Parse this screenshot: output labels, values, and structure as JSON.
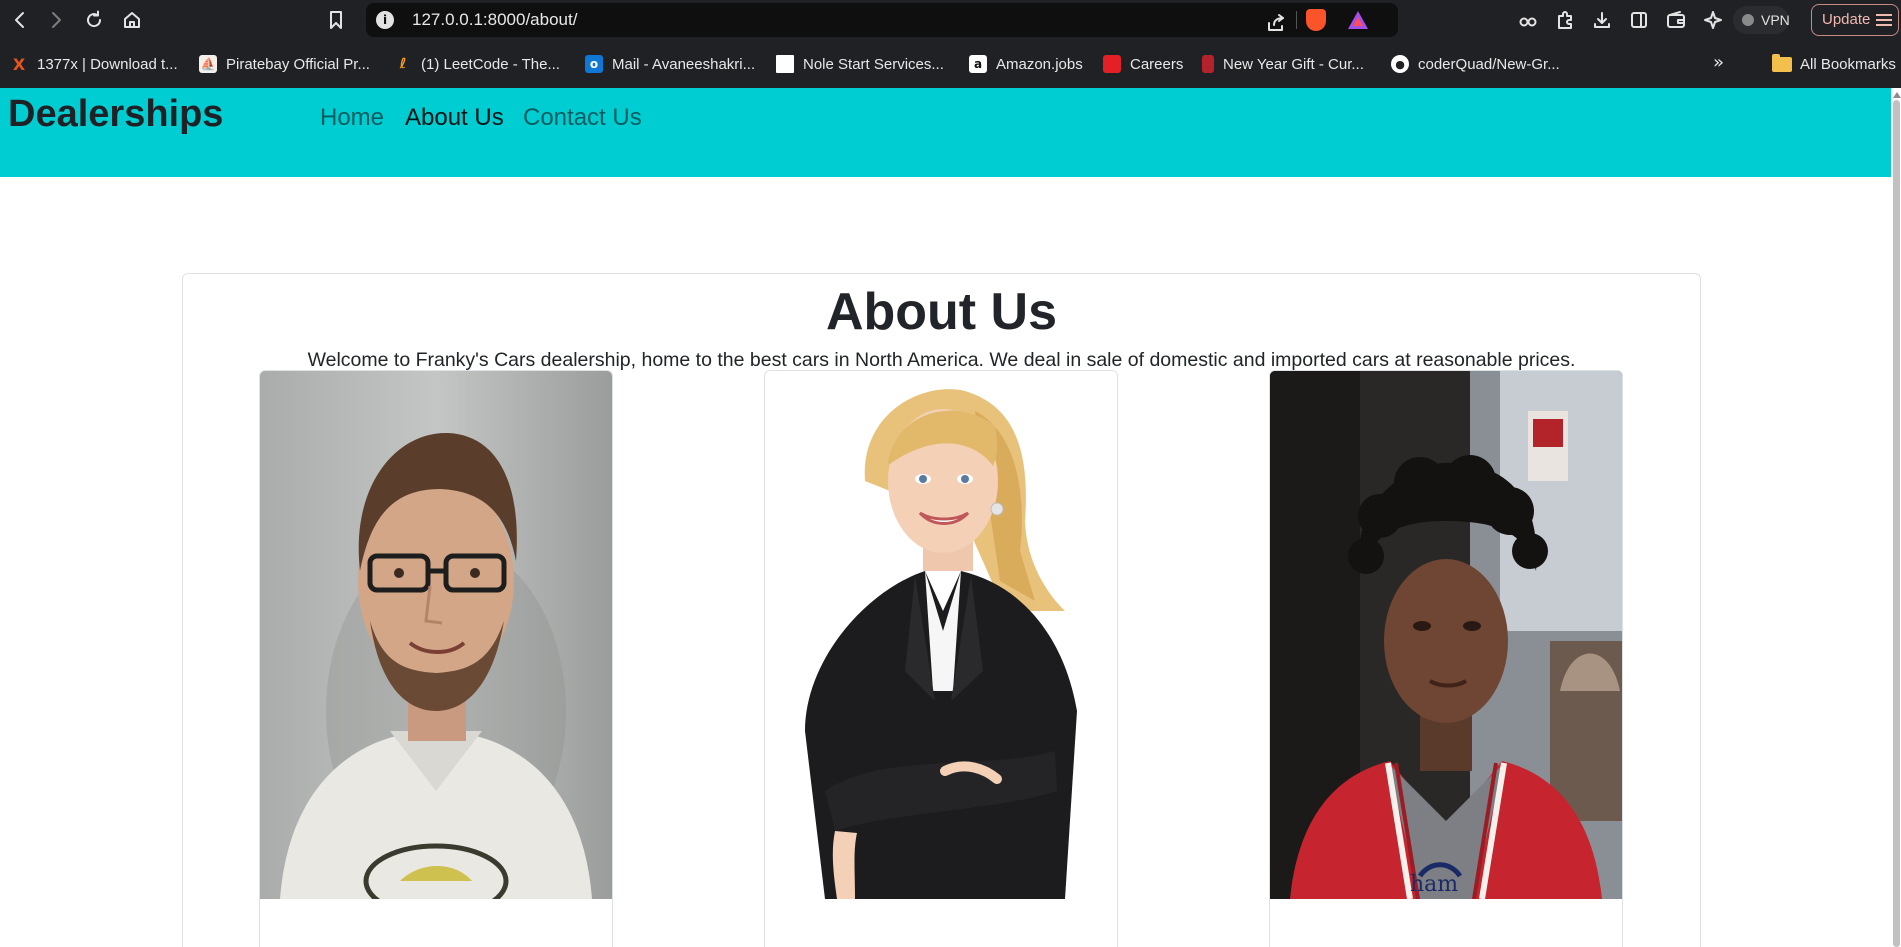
{
  "browser": {
    "url": "127.0.0.1:8000/about/",
    "vpn_label": "VPN",
    "update_label": "Update",
    "bookmarks": [
      {
        "label": "1377x | Download t...",
        "icon": "x-icon",
        "color": "#e8541e"
      },
      {
        "label": "Piratebay Official Pr...",
        "icon": "ship-icon",
        "color": "#f4efe8"
      },
      {
        "label": "(1) LeetCode - The...",
        "icon": "leetcode-icon",
        "color": "#f89f1b"
      },
      {
        "label": "Mail - Avaneeshakri...",
        "icon": "outlook-icon",
        "color": "#0f78d4"
      },
      {
        "label": "Nole Start Services...",
        "icon": "blank-page-icon",
        "color": "#ffffff"
      },
      {
        "label": "Amazon.jobs",
        "icon": "amazon-icon",
        "color": "#ffffff"
      },
      {
        "label": "Careers",
        "icon": "careers-icon",
        "color": "#e41f26"
      },
      {
        "label": "New Year Gift - Cur...",
        "icon": "gift-icon",
        "color": "#b4232a"
      },
      {
        "label": "coderQuad/New-Gr...",
        "icon": "github-icon",
        "color": "#ffffff"
      }
    ],
    "all_bookmarks_label": "All Bookmarks"
  },
  "site": {
    "brand": "Dealerships",
    "nav": {
      "home": "Home",
      "about": "About Us",
      "contact": "Contact Us"
    },
    "accent_color": "#00cdd1"
  },
  "about": {
    "title": "About Us",
    "text": "Welcome to Franky's Cars dealership, home to the best cars in North America. We deal in sale of domestic and imported cars at reasonable prices.",
    "people": [
      {
        "photo": "man-with-glasses-photo"
      },
      {
        "photo": "woman-in-blazer-photo"
      },
      {
        "photo": "man-in-red-jacket-photo"
      }
    ]
  }
}
